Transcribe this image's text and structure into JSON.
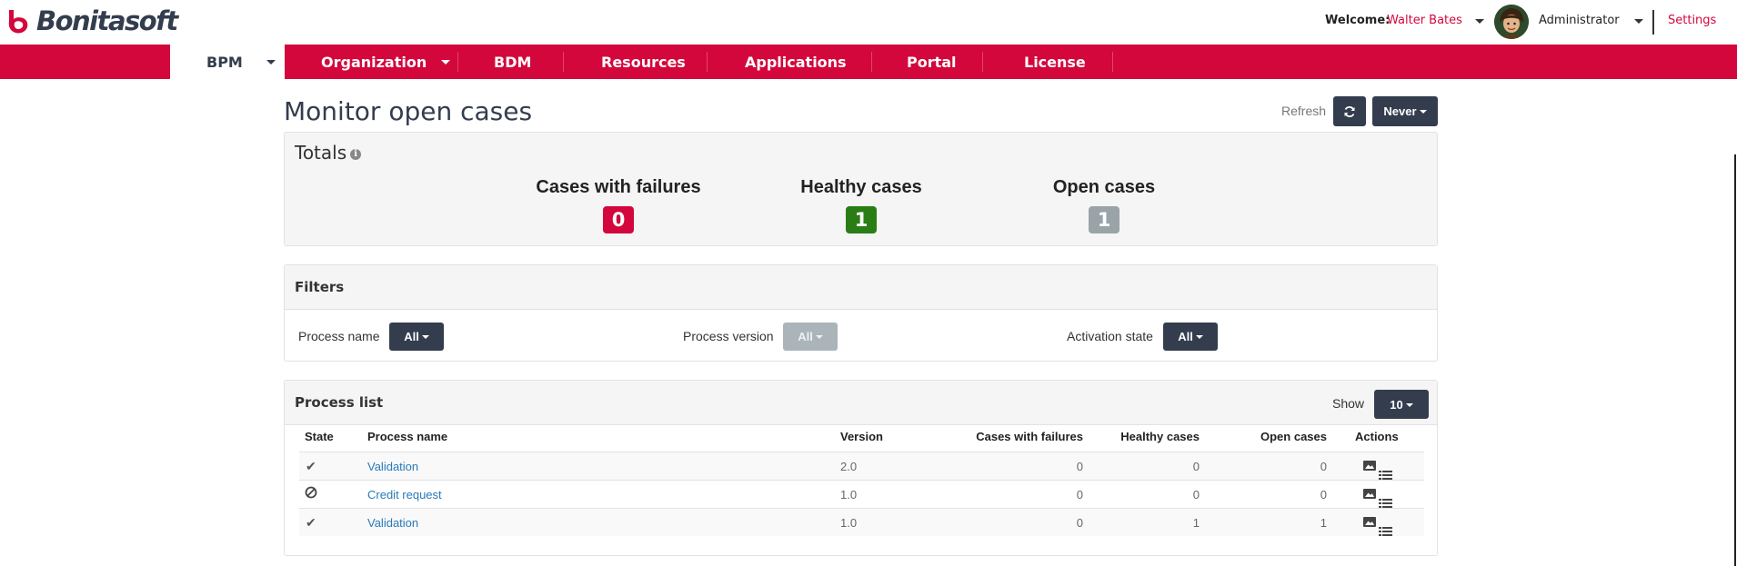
{
  "header": {
    "logo_text": "Bonitasoft",
    "welcome_label": "Welcome:",
    "user_name": "Walter Bates",
    "profile": "Administrator",
    "settings_label": "Settings"
  },
  "nav": {
    "items": [
      {
        "label": "BPM"
      },
      {
        "label": "Organization"
      },
      {
        "label": "BDM"
      },
      {
        "label": "Resources"
      },
      {
        "label": "Applications"
      },
      {
        "label": "Portal"
      },
      {
        "label": "License"
      }
    ]
  },
  "page": {
    "title": "Monitor open cases",
    "refresh_label": "Refresh",
    "refresh_interval": "Never"
  },
  "totals": {
    "title": "Totals",
    "stats": [
      {
        "label": "Cases with failures",
        "value": "0",
        "color": "#d3073c"
      },
      {
        "label": "Healthy cases",
        "value": "1",
        "color": "#2a7d14"
      },
      {
        "label": "Open cases",
        "value": "1",
        "color": "#9aa3a8"
      }
    ]
  },
  "filters": {
    "title": "Filters",
    "process_name_label": "Process name",
    "process_name_value": "All",
    "process_version_label": "Process version",
    "process_version_value": "All",
    "activation_state_label": "Activation state",
    "activation_state_value": "All"
  },
  "process_list": {
    "title": "Process list",
    "show_label": "Show",
    "page_size": "10",
    "columns": [
      "State",
      "Process name",
      "Version",
      "Cases with failures",
      "Healthy cases",
      "Open cases",
      "Actions"
    ],
    "rows": [
      {
        "state_icon": "check-icon",
        "name": "Validation",
        "version": "2.0",
        "failures": "0",
        "healthy": "0",
        "open": "0"
      },
      {
        "state_icon": "ban-icon",
        "name": "Credit request",
        "version": "1.0",
        "failures": "0",
        "healthy": "0",
        "open": "0"
      },
      {
        "state_icon": "check-icon",
        "name": "Validation",
        "version": "1.0",
        "failures": "0",
        "healthy": "1",
        "open": "1"
      }
    ]
  }
}
